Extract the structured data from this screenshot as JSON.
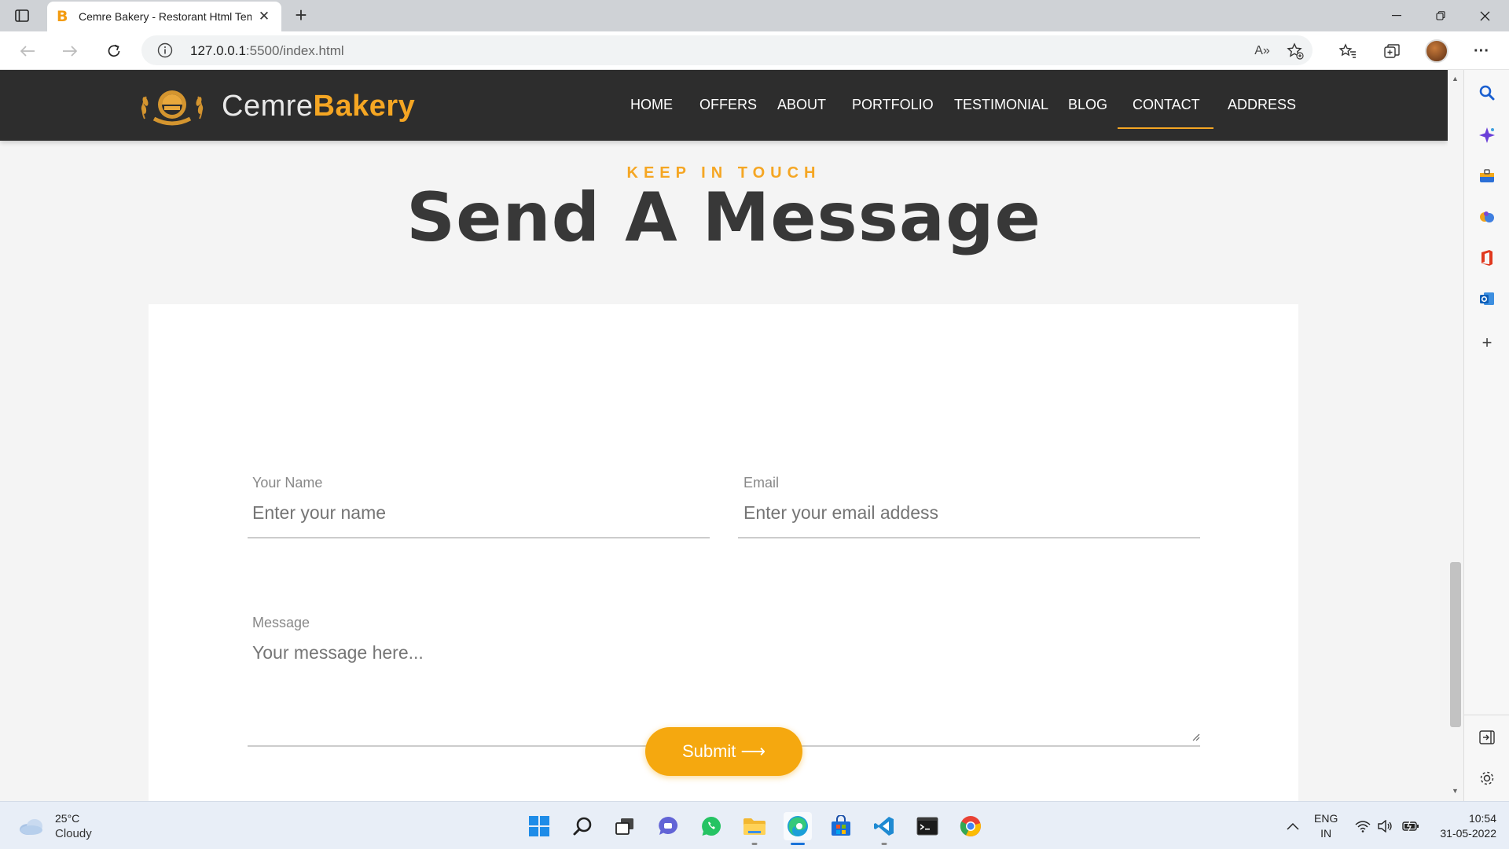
{
  "browser": {
    "tab_title": "Cemre Bakery - Restorant Html Template",
    "tab_favicon": "B",
    "url_host": "127.0.0.1",
    "url_rest": ":5500/index.html",
    "read_aloud": "A»"
  },
  "site": {
    "logo_light": "Cemre",
    "logo_bold": "Bakery",
    "nav": [
      "HOME",
      "OFFERS",
      "ABOUT",
      "PORTFOLIO",
      "TESTIMONIAL",
      "BLOG",
      "CONTACT",
      "ADDRESS"
    ],
    "active_nav": "CONTACT",
    "subtitle": "KEEP IN TOUCH",
    "heading": "Send A Message",
    "form": {
      "name_label": "Your Name",
      "name_placeholder": "Enter your name",
      "email_label": "Email",
      "email_placeholder": "Enter your email addess",
      "message_label": "Message",
      "message_placeholder": "Your message here...",
      "submit_label": "Submit ⟶"
    },
    "accent_color": "#f5a623"
  },
  "taskbar": {
    "temperature": "25°C",
    "weather": "Cloudy",
    "lang_top": "ENG",
    "lang_bottom": "IN",
    "time": "10:54",
    "date": "31-05-2022"
  }
}
